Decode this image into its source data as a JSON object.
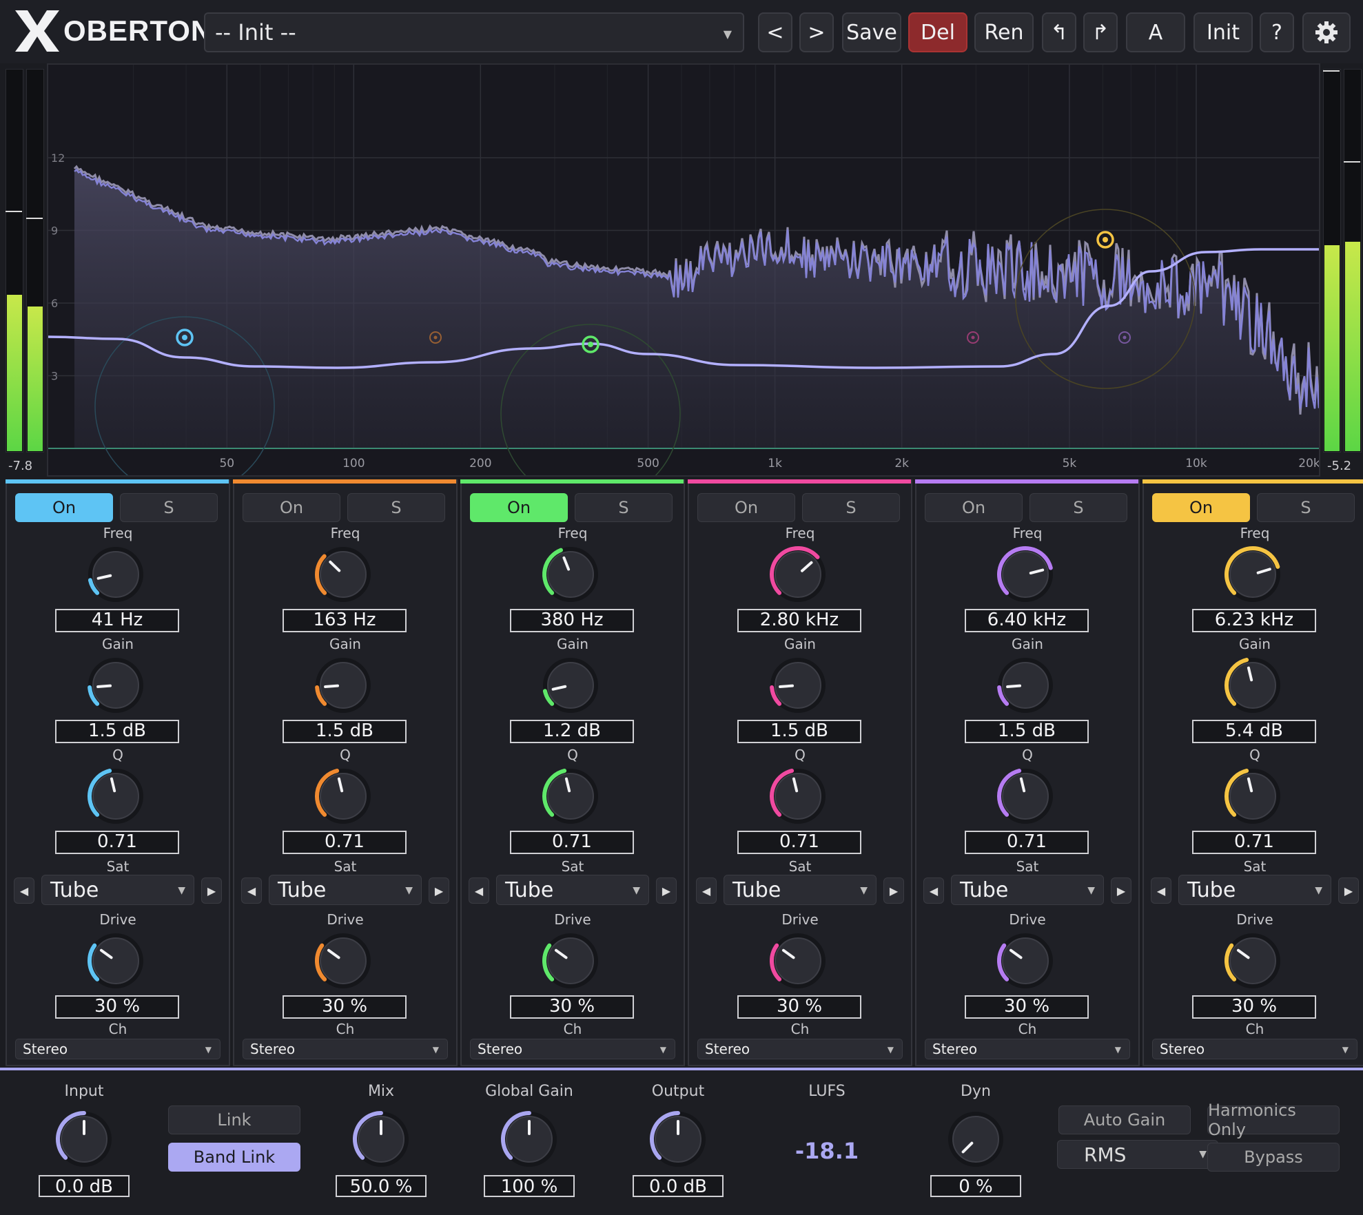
{
  "app": {
    "name": "OBERTON"
  },
  "toolbar": {
    "preset": "-- Init --",
    "prev": "<",
    "next": ">",
    "save": "Save",
    "del": "Del",
    "ren": "Ren",
    "undo": "↰",
    "redo": "↱",
    "ab": "A",
    "init": "Init",
    "help": "?"
  },
  "meters": {
    "left_readout": "-7.8",
    "right_readout": "-5.2",
    "left_levels": [
      0.41,
      0.38
    ],
    "right_levels": [
      0.54,
      0.55
    ]
  },
  "display": {
    "db_ticks": [
      "12",
      "9",
      "6",
      "3"
    ],
    "freq_ticks": [
      "50",
      "100",
      "200",
      "500",
      "1k",
      "2k",
      "5k",
      "10k",
      "20k"
    ]
  },
  "bands": [
    {
      "color": "#5ec4f4",
      "on": true,
      "on_label": "On",
      "solo_label": "S",
      "freq_label": "Freq",
      "freq": "41 Hz",
      "gain_label": "Gain",
      "gain": "1.5 dB",
      "q_label": "Q",
      "q": "0.71",
      "sat_label": "Sat",
      "sat": "Tube",
      "drive_label": "Drive",
      "drive": "30 %",
      "ch_label": "Ch",
      "ch": "Stereo",
      "knob_freq": 0.12,
      "knob_gain": 0.15,
      "knob_q": 0.45,
      "knob_drive": 0.3
    },
    {
      "color": "#f08a30",
      "on": false,
      "on_label": "On",
      "solo_label": "S",
      "freq_label": "Freq",
      "freq": "163 Hz",
      "gain_label": "Gain",
      "gain": "1.5 dB",
      "q_label": "Q",
      "q": "0.71",
      "sat_label": "Sat",
      "sat": "Tube",
      "drive_label": "Drive",
      "drive": "30 %",
      "ch_label": "Ch",
      "ch": "Stereo",
      "knob_freq": 0.33,
      "knob_gain": 0.15,
      "knob_q": 0.45,
      "knob_drive": 0.3
    },
    {
      "color": "#5fe86a",
      "on": true,
      "on_label": "On",
      "solo_label": "S",
      "freq_label": "Freq",
      "freq": "380 Hz",
      "gain_label": "Gain",
      "gain": "1.2 dB",
      "q_label": "Q",
      "q": "0.71",
      "sat_label": "Sat",
      "sat": "Tube",
      "drive_label": "Drive",
      "drive": "30 %",
      "ch_label": "Ch",
      "ch": "Stereo",
      "knob_freq": 0.42,
      "knob_gain": 0.12,
      "knob_q": 0.45,
      "knob_drive": 0.3
    },
    {
      "color": "#f04aa0",
      "on": false,
      "on_label": "On",
      "solo_label": "S",
      "freq_label": "Freq",
      "freq": "2.80 kHz",
      "gain_label": "Gain",
      "gain": "1.5 dB",
      "q_label": "Q",
      "q": "0.71",
      "sat_label": "Sat",
      "sat": "Tube",
      "drive_label": "Drive",
      "drive": "30 %",
      "ch_label": "Ch",
      "ch": "Stereo",
      "knob_freq": 0.68,
      "knob_gain": 0.15,
      "knob_q": 0.45,
      "knob_drive": 0.3
    },
    {
      "color": "#b67cf2",
      "on": false,
      "on_label": "On",
      "solo_label": "S",
      "freq_label": "Freq",
      "freq": "6.40 kHz",
      "gain_label": "Gain",
      "gain": "1.5 dB",
      "q_label": "Q",
      "q": "0.71",
      "sat_label": "Sat",
      "sat": "Tube",
      "drive_label": "Drive",
      "drive": "30 %",
      "ch_label": "Ch",
      "ch": "Stereo",
      "knob_freq": 0.78,
      "knob_gain": 0.15,
      "knob_q": 0.45,
      "knob_drive": 0.3
    },
    {
      "color": "#f5c443",
      "on": true,
      "on_label": "On",
      "solo_label": "S",
      "freq_label": "Freq",
      "freq": "6.23 kHz",
      "gain_label": "Gain",
      "gain": "5.4 dB",
      "q_label": "Q",
      "q": "0.71",
      "sat_label": "Sat",
      "sat": "Tube",
      "drive_label": "Drive",
      "drive": "30 %",
      "ch_label": "Ch",
      "ch": "Stereo",
      "knob_freq": 0.77,
      "knob_gain": 0.45,
      "knob_q": 0.45,
      "knob_drive": 0.3
    }
  ],
  "global": {
    "input_label": "Input",
    "input": "0.0 dB",
    "knob_input": 0.5,
    "link": "Link",
    "band_link": "Band Link",
    "mix_label": "Mix",
    "mix": "50.0 %",
    "knob_mix": 0.5,
    "global_gain_label": "Global Gain",
    "global_gain": "100 %",
    "knob_global_gain": 0.5,
    "output_label": "Output",
    "output": "0.0 dB",
    "knob_output": 0.5,
    "lufs_label": "LUFS",
    "lufs": "-18.1",
    "dyn_label": "Dyn",
    "dyn": "0 %",
    "knob_dyn": 0.0,
    "auto_gain": "Auto Gain",
    "rms": "RMS",
    "harmonics_only": "Harmonics Only",
    "bypass": "Bypass"
  },
  "colors": {
    "accent": "#a9a6f0",
    "curve": "#b3b0ff",
    "background": "#1b1c21"
  }
}
